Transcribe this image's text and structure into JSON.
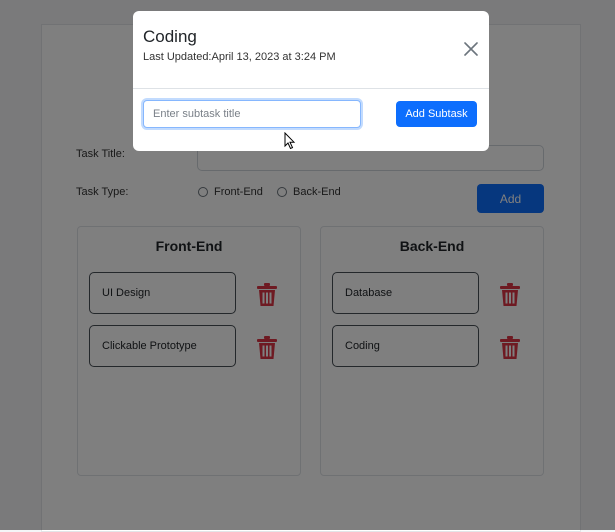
{
  "form": {
    "task_title_label": "Task Title:",
    "task_type_label": "Task Type:",
    "task_type_options": [
      "Front-End",
      "Back-End"
    ],
    "add_label": "Add"
  },
  "columns": [
    {
      "title": "Front-End",
      "tasks": [
        "UI Design",
        "Clickable Prototype"
      ]
    },
    {
      "title": "Back-End",
      "tasks": [
        "Database",
        "Coding"
      ]
    }
  ],
  "modal": {
    "title": "Coding",
    "subtitle": "Last Updated:April 13, 2023 at 3:24 PM",
    "subtask_placeholder": "Enter subtask title",
    "add_subtask_label": "Add Subtask",
    "close_icon": "close-icon"
  },
  "icons": {
    "delete": "trash-icon"
  },
  "colors": {
    "primary": "#0d6efd",
    "delete": "#dc3545",
    "backdrop": "rgba(0,0,0,0.5)"
  }
}
